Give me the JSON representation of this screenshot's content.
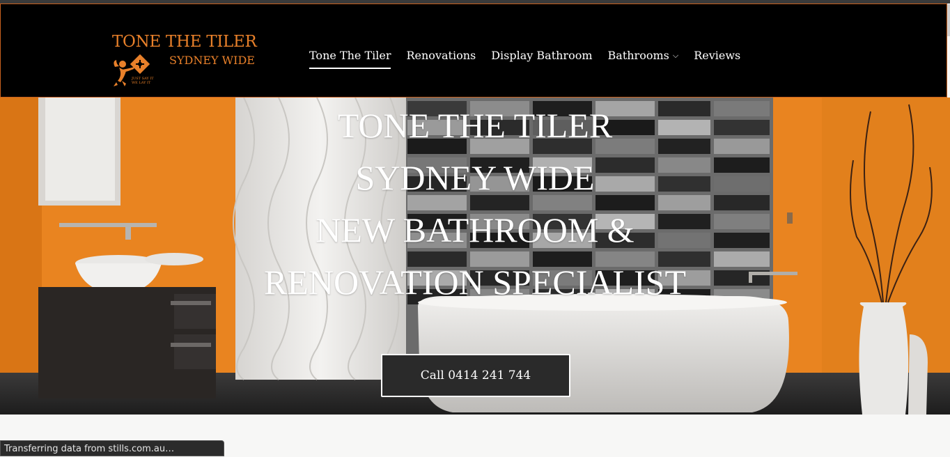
{
  "logo": {
    "name_line1": "TONE THE TILER",
    "name_line2": "SYDNEY WIDE",
    "tagline_line1": "JUST SAY IT",
    "tagline_line2": "WE LAY IT"
  },
  "nav": {
    "items": [
      {
        "label": "Tone The Tiler",
        "active": true
      },
      {
        "label": "Renovations"
      },
      {
        "label": "Display Bathroom"
      },
      {
        "label": "Bathrooms",
        "has_dropdown": true
      },
      {
        "label": "Reviews"
      }
    ]
  },
  "hero": {
    "line1": "TONE THE TILER",
    "line2": "SYDNEY WIDE",
    "line3": "NEW BATHROOM &",
    "line4": "RENOVATION SPECIALIST",
    "cta_label": "Call 0414 241 744"
  },
  "status_bar": {
    "text": "Transferring data from stills.com.au…"
  },
  "colors": {
    "accent": "#e8802a",
    "header_bg": "#000000",
    "header_border": "#c8611f",
    "cta_bg": "#2a2a2a",
    "wall_orange": "#e98420"
  }
}
